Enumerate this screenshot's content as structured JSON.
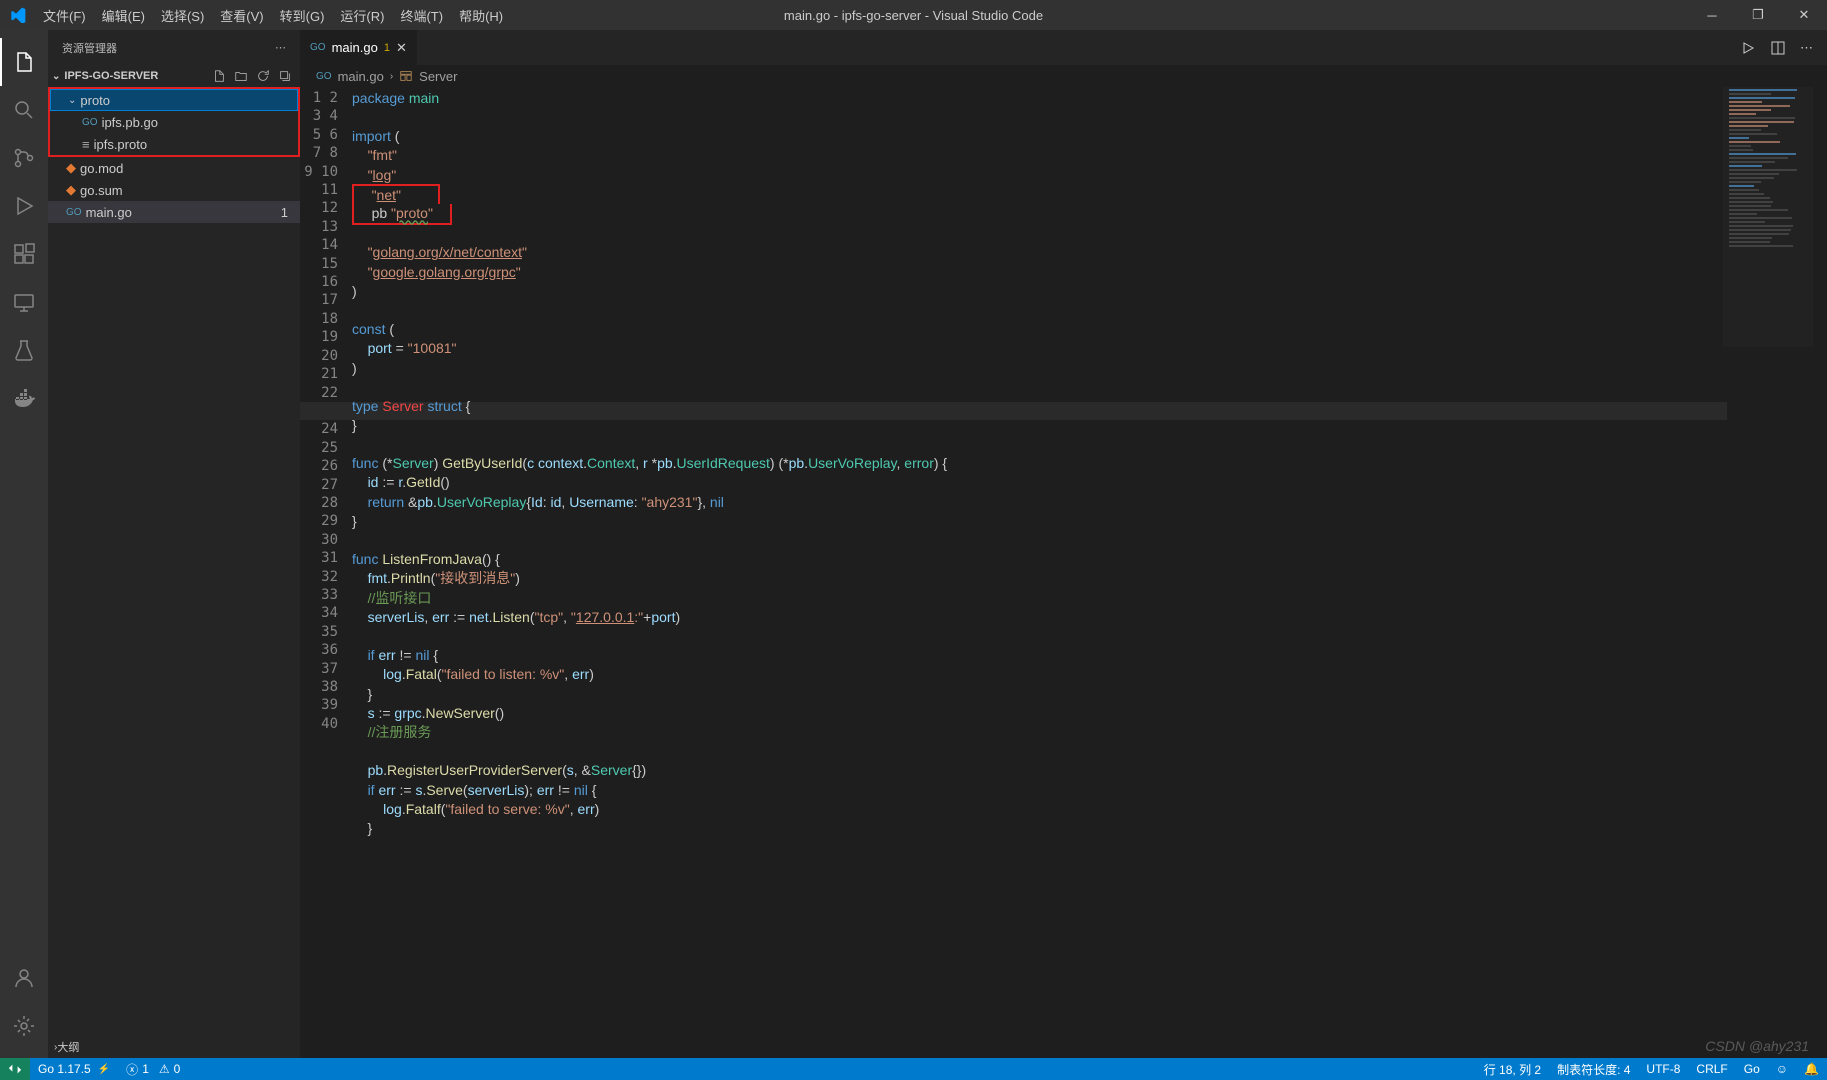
{
  "window": {
    "title": "main.go - ipfs-go-server - Visual Studio Code"
  },
  "menu": [
    "文件(F)",
    "编辑(E)",
    "选择(S)",
    "查看(V)",
    "转到(G)",
    "运行(R)",
    "终端(T)",
    "帮助(H)"
  ],
  "sidebar": {
    "title": "资源管理器",
    "section": "IPFS-GO-SERVER",
    "tree": [
      {
        "name": "proto",
        "kind": "folder",
        "depth": 0,
        "expanded": true,
        "selected": true
      },
      {
        "name": "ipfs.pb.go",
        "kind": "go",
        "depth": 1
      },
      {
        "name": "ipfs.proto",
        "kind": "proto",
        "depth": 1
      },
      {
        "name": "go.mod",
        "kind": "mod",
        "depth": 0
      },
      {
        "name": "go.sum",
        "kind": "sum",
        "depth": 0
      },
      {
        "name": "main.go",
        "kind": "go",
        "depth": 0,
        "active": true,
        "badge": "1"
      }
    ],
    "outline": "大纲"
  },
  "tabs": [
    {
      "label": "main.go",
      "icon": "go",
      "problems": "1",
      "active": true
    }
  ],
  "breadcrumb": {
    "file": "main.go",
    "symbol": "Server"
  },
  "code": {
    "lines": 40,
    "highlightLine": 18,
    "tokens": [
      [
        [
          "package ",
          "kw"
        ],
        [
          "main",
          "pkg"
        ]
      ],
      [],
      [
        [
          "import ",
          "kw"
        ],
        [
          "(",
          ""
        ]
      ],
      [
        [
          "    ",
          ""
        ],
        [
          "\"fmt\"",
          "str"
        ]
      ],
      [
        [
          "    ",
          ""
        ],
        [
          "\"",
          "str"
        ],
        [
          "log",
          "str und"
        ],
        [
          "\"",
          "str"
        ]
      ],
      [
        [
          "    ",
          ""
        ],
        [
          "\"",
          "str"
        ],
        [
          "net",
          "str und"
        ],
        [
          "\"",
          "str"
        ]
      ],
      [
        [
          "    ",
          ""
        ],
        [
          "pb ",
          ""
        ],
        [
          "\"",
          "str"
        ],
        [
          "proto",
          "str wavy"
        ],
        [
          "\"",
          "str"
        ]
      ],
      [],
      [
        [
          "    ",
          ""
        ],
        [
          "\"",
          "str"
        ],
        [
          "golang.org/x/net/context",
          "str und"
        ],
        [
          "\"",
          "str"
        ]
      ],
      [
        [
          "    ",
          ""
        ],
        [
          "\"",
          "str"
        ],
        [
          "google.golang.org/grpc",
          "str und"
        ],
        [
          "\"",
          "str"
        ]
      ],
      [
        [
          ")",
          ""
        ]
      ],
      [],
      [
        [
          "const ",
          "kw"
        ],
        [
          "(",
          ""
        ]
      ],
      [
        [
          "    ",
          ""
        ],
        [
          "port",
          "ident"
        ],
        [
          " = ",
          ""
        ],
        [
          "\"10081\"",
          "str"
        ]
      ],
      [
        [
          ")",
          ""
        ]
      ],
      [],
      [
        [
          "type ",
          "kw"
        ],
        [
          "Server",
          "err"
        ],
        [
          " ",
          ""
        ],
        [
          "struct",
          "kw"
        ],
        [
          " {",
          ""
        ]
      ],
      [
        [
          "}",
          ""
        ]
      ],
      [],
      [
        [
          "func ",
          "kw"
        ],
        [
          "(*",
          ""
        ],
        [
          "Server",
          "typ"
        ],
        [
          ") ",
          ""
        ],
        [
          "GetByUserId",
          "fn"
        ],
        [
          "(",
          ""
        ],
        [
          "c",
          "ident"
        ],
        [
          " ",
          ""
        ],
        [
          "context",
          "ident"
        ],
        [
          ".",
          ""
        ],
        [
          "Context",
          "typ"
        ],
        [
          ", ",
          ""
        ],
        [
          "r",
          "ident"
        ],
        [
          " *",
          ""
        ],
        [
          "pb",
          "ident"
        ],
        [
          ".",
          ""
        ],
        [
          "UserIdRequest",
          "typ"
        ],
        [
          ") (*",
          ""
        ],
        [
          "pb",
          "ident"
        ],
        [
          ".",
          ""
        ],
        [
          "UserVoReplay",
          "typ"
        ],
        [
          ", ",
          ""
        ],
        [
          "error",
          "typ"
        ],
        [
          ") {",
          ""
        ]
      ],
      [
        [
          "    ",
          ""
        ],
        [
          "id",
          "ident"
        ],
        [
          " := ",
          ""
        ],
        [
          "r",
          "ident"
        ],
        [
          ".",
          ""
        ],
        [
          "GetId",
          "fn"
        ],
        [
          "()",
          ""
        ]
      ],
      [
        [
          "    ",
          ""
        ],
        [
          "return ",
          "kw"
        ],
        [
          "&",
          ""
        ],
        [
          "pb",
          "ident"
        ],
        [
          ".",
          ""
        ],
        [
          "UserVoReplay",
          "typ"
        ],
        [
          "{",
          ""
        ],
        [
          "Id",
          "ident"
        ],
        [
          ": ",
          ""
        ],
        [
          "id",
          "ident"
        ],
        [
          ", ",
          ""
        ],
        [
          "Username",
          "ident"
        ],
        [
          ": ",
          ""
        ],
        [
          "\"ahy231\"",
          "str"
        ],
        [
          "}, ",
          ""
        ],
        [
          "nil",
          "kw"
        ]
      ],
      [
        [
          "}",
          ""
        ]
      ],
      [],
      [
        [
          "func ",
          "kw"
        ],
        [
          "ListenFromJava",
          "fn"
        ],
        [
          "() {",
          ""
        ]
      ],
      [
        [
          "    ",
          ""
        ],
        [
          "fmt",
          "ident"
        ],
        [
          ".",
          ""
        ],
        [
          "Println",
          "fn"
        ],
        [
          "(",
          ""
        ],
        [
          "\"接收到消息\"",
          "str"
        ],
        [
          ")",
          ""
        ]
      ],
      [
        [
          "    ",
          ""
        ],
        [
          "//监听接口",
          "cmt"
        ]
      ],
      [
        [
          "    ",
          ""
        ],
        [
          "serverLis",
          "ident"
        ],
        [
          ", ",
          ""
        ],
        [
          "err",
          "ident"
        ],
        [
          " := ",
          ""
        ],
        [
          "net",
          "ident"
        ],
        [
          ".",
          ""
        ],
        [
          "Listen",
          "fn"
        ],
        [
          "(",
          ""
        ],
        [
          "\"tcp\"",
          "str"
        ],
        [
          ", ",
          ""
        ],
        [
          "\"",
          "str"
        ],
        [
          "127.0.0.1",
          "str und"
        ],
        [
          ":\"",
          "str"
        ],
        [
          "+",
          ""
        ],
        [
          "port",
          "ident"
        ],
        [
          ")",
          ""
        ]
      ],
      [],
      [
        [
          "    ",
          ""
        ],
        [
          "if ",
          "kw"
        ],
        [
          "err",
          "ident"
        ],
        [
          " != ",
          ""
        ],
        [
          "nil",
          "kw"
        ],
        [
          " {",
          ""
        ]
      ],
      [
        [
          "        ",
          ""
        ],
        [
          "log",
          "ident"
        ],
        [
          ".",
          ""
        ],
        [
          "Fatal",
          "fn"
        ],
        [
          "(",
          ""
        ],
        [
          "\"failed to listen: %v\"",
          "str"
        ],
        [
          ", ",
          ""
        ],
        [
          "err",
          "ident"
        ],
        [
          ")",
          ""
        ]
      ],
      [
        [
          "    }",
          ""
        ]
      ],
      [
        [
          "    ",
          ""
        ],
        [
          "s",
          "ident"
        ],
        [
          " := ",
          ""
        ],
        [
          "grpc",
          "ident"
        ],
        [
          ".",
          ""
        ],
        [
          "NewServer",
          "fn"
        ],
        [
          "()",
          ""
        ]
      ],
      [
        [
          "    ",
          ""
        ],
        [
          "//注册服务",
          "cmt"
        ]
      ],
      [],
      [
        [
          "    ",
          ""
        ],
        [
          "pb",
          "ident"
        ],
        [
          ".",
          ""
        ],
        [
          "RegisterUserProviderServer",
          "fn"
        ],
        [
          "(",
          ""
        ],
        [
          "s",
          "ident"
        ],
        [
          ", &",
          ""
        ],
        [
          "Server",
          "typ"
        ],
        [
          "{})",
          ""
        ]
      ],
      [
        [
          "    ",
          ""
        ],
        [
          "if ",
          "kw"
        ],
        [
          "err",
          "ident"
        ],
        [
          " := ",
          ""
        ],
        [
          "s",
          "ident"
        ],
        [
          ".",
          ""
        ],
        [
          "Serve",
          "fn"
        ],
        [
          "(",
          ""
        ],
        [
          "serverLis",
          "ident"
        ],
        [
          "); ",
          ""
        ],
        [
          "err",
          "ident"
        ],
        [
          " != ",
          ""
        ],
        [
          "nil",
          "kw"
        ],
        [
          " {",
          ""
        ]
      ],
      [
        [
          "        ",
          ""
        ],
        [
          "log",
          "ident"
        ],
        [
          ".",
          ""
        ],
        [
          "Fatalf",
          "fn"
        ],
        [
          "(",
          ""
        ],
        [
          "\"failed to serve: %v\"",
          "str"
        ],
        [
          ", ",
          ""
        ],
        [
          "err",
          "ident"
        ],
        [
          ")",
          ""
        ]
      ],
      [
        [
          "    }",
          ""
        ]
      ],
      []
    ]
  },
  "status": {
    "go": "Go 1.17.5",
    "errors": "1",
    "warnings": "0",
    "line_col": "行 18, 列 2",
    "tabsize": "制表符长度: 4",
    "encoding": "UTF-8",
    "eol": "CRLF",
    "lang": "Go",
    "watermark": "CSDN @ahy231",
    "notif": "✓   ⊘"
  }
}
